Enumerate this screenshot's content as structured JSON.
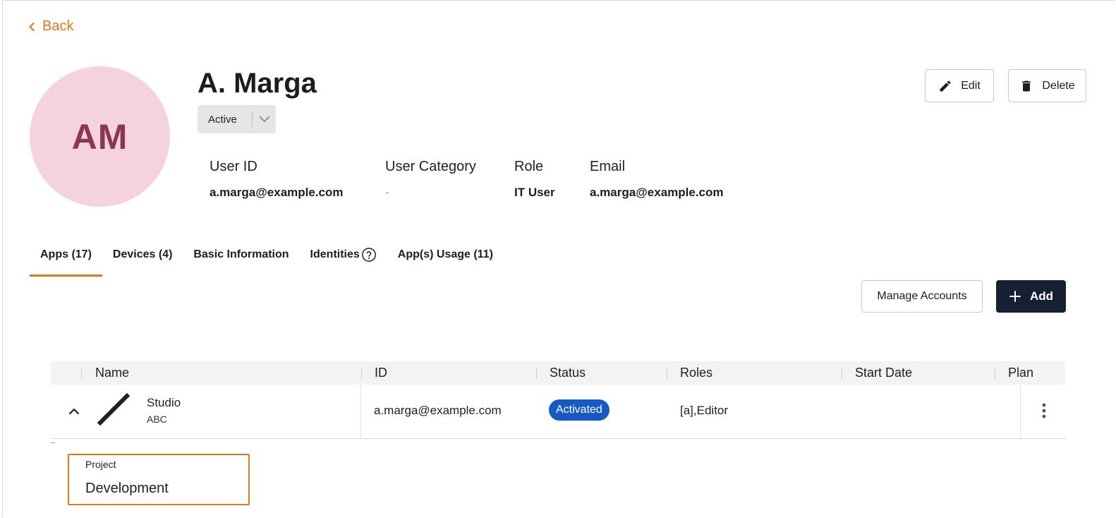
{
  "nav": {
    "back_label": "Back"
  },
  "user": {
    "initials": "AM",
    "name": "A. Marga",
    "status": "Active"
  },
  "actions": {
    "edit_label": "Edit",
    "delete_label": "Delete"
  },
  "info": [
    {
      "key": "User ID",
      "value": "a.marga@example.com"
    },
    {
      "key": "User Category",
      "value": "-"
    },
    {
      "key": "Role",
      "value": "IT User"
    },
    {
      "key": "Email",
      "value": "a.marga@example.com"
    }
  ],
  "tabs": [
    {
      "label": "Apps (17)"
    },
    {
      "label": "Devices (4)"
    },
    {
      "label": "Basic Information"
    },
    {
      "label": "Identities"
    },
    {
      "label": "App(s) Usage (11)"
    }
  ],
  "apps_toolbar": {
    "manage_label": "Manage Accounts",
    "add_label": "Add"
  },
  "table": {
    "columns": [
      "Name",
      "ID",
      "Status",
      "Roles",
      "Start Date",
      "Plan"
    ],
    "rows": [
      {
        "name": "Studio",
        "subtitle": "ABC",
        "id": "a.marga@example.com",
        "status": "Activated",
        "roles": "[a],Editor",
        "start_date": "",
        "plan": ""
      }
    ]
  },
  "expanded": {
    "project_label": "Project",
    "project_value": "Development"
  },
  "colors": {
    "accent": "#e4761b",
    "avatar_bg": "#f5d3de",
    "avatar_text": "#8c3752",
    "primary_button": "#152032",
    "status_badge": "#1658c4"
  },
  "icons": [
    "chevron-left-icon",
    "chevron-down-icon",
    "pencil-icon",
    "trash-icon",
    "help-circle-icon",
    "plus-icon",
    "chevron-up-icon",
    "app-logo-slash-icon",
    "kebab-menu-icon"
  ]
}
